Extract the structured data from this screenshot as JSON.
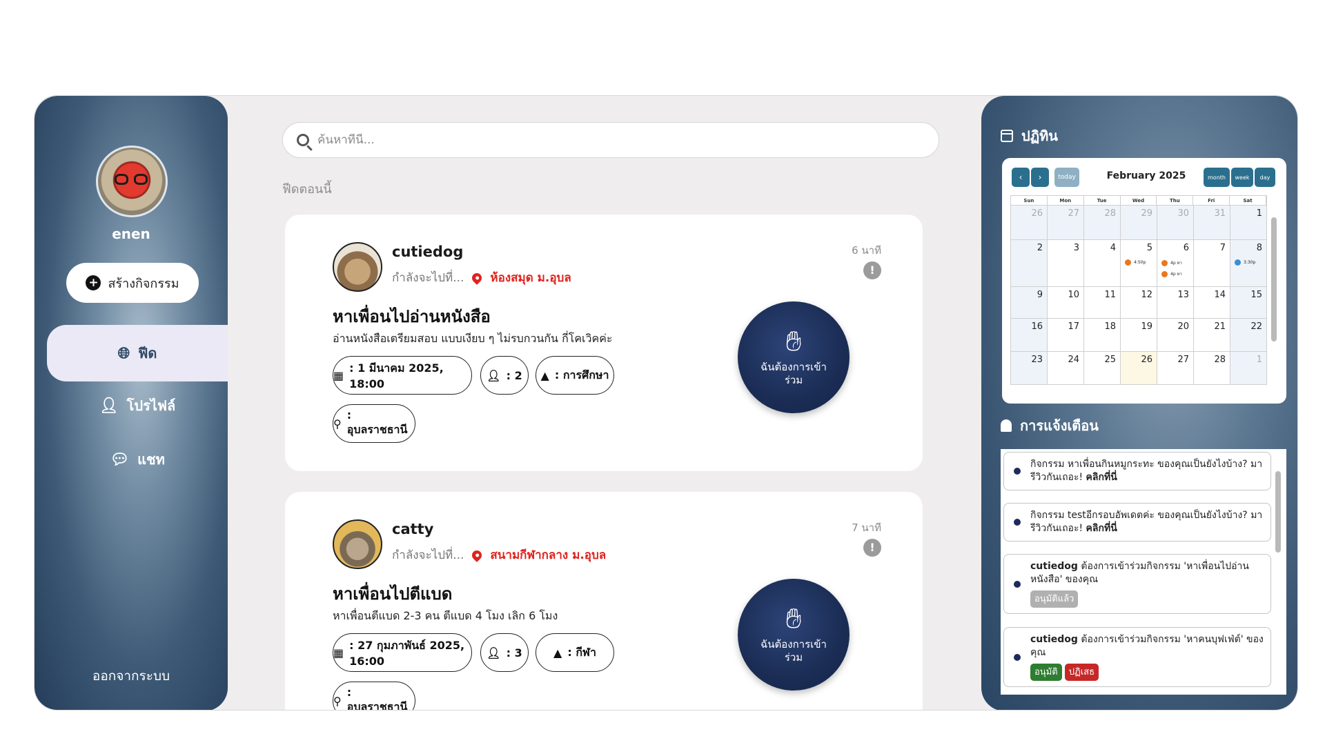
{
  "sidebar": {
    "username": "enen",
    "create_label": "สร้างกิจกรรม",
    "nav": [
      {
        "label": "ฟีด",
        "icon": "globe-icon"
      },
      {
        "label": "โปรไฟล์",
        "icon": "user-icon"
      },
      {
        "label": "แชท",
        "icon": "chat-icon"
      }
    ],
    "logout_label": "ออกจากระบบ"
  },
  "search": {
    "placeholder": "ค้นหาที่นี่..."
  },
  "feed": {
    "section_title": "ฟีดตอนนี้",
    "going_label": "กำลังจะไปที่...",
    "join_label": "ฉันต้องการเข้าร่วม",
    "posts": [
      {
        "username": "cutiedog",
        "place": "ห้องสมุด ม.อุบล",
        "time_ago": "6 นาที",
        "title": "หาเพื่อนไปอ่านหนังสือ",
        "description": "อ่านหนังสือเตรียมสอบ แบบเงียบ ๆ ไม่รบกวนกัน กี่โคเวิคค่ะ",
        "date": ": 1 มีนาคม 2025, 18:00",
        "people": ": 2",
        "category": ": การศึกษา",
        "province": ": อุบลราชธานี"
      },
      {
        "username": "catty",
        "place": "สนามกีฬากลาง ม.อุบล",
        "time_ago": "7 นาที",
        "title": "หาเพื่อนไปตีแบด",
        "description": "หาเพื่อนตีแบด 2-3 คน ตีแบด 4 โมง เลิก 6 โมง",
        "date": ": 27 กุมภาพันธ์ 2025, 16:00",
        "people": ": 3",
        "category": ": กีฬา",
        "province": ": อุบลราชธานี"
      }
    ]
  },
  "calendar": {
    "heading": "ปฏิทิน",
    "month_title": "February 2025",
    "today_label": "today",
    "view_buttons": [
      "month",
      "week",
      "day"
    ],
    "days_of_week": [
      "Sun",
      "Mon",
      "Tue",
      "Wed",
      "Thu",
      "Fri",
      "Sat"
    ],
    "weeks": [
      [
        "26",
        "27",
        "28",
        "29",
        "30",
        "31",
        "1"
      ],
      [
        "2",
        "3",
        "4",
        "5",
        "6",
        "7",
        "8"
      ],
      [
        "9",
        "10",
        "11",
        "12",
        "13",
        "14",
        "15"
      ],
      [
        "16",
        "17",
        "18",
        "19",
        "20",
        "21",
        "22"
      ],
      [
        "23",
        "24",
        "25",
        "26",
        "27",
        "28",
        "1"
      ]
    ],
    "events": [
      {
        "label": "4:50p",
        "color": "#e8781e"
      },
      {
        "label": "4p หา",
        "color": "#e8781e"
      },
      {
        "label": "4p หา",
        "color": "#e8781e"
      },
      {
        "label": "3:30p",
        "color": "#3a8fd6"
      }
    ]
  },
  "notifications": {
    "heading": "การแจ้งเตือน",
    "items": [
      {
        "text": "กิจกรรม หาเพื่อนกินหมูกระทะ ของคุณเป็นยังไงบ้าง? มารีวิวกันเถอะ! ",
        "link": "คลิกที่นี่"
      },
      {
        "text": "กิจกรรม testอีกรอบอัพเดตค่ะ ของคุณเป็นยังไงบ้าง? มารีวิวกันเถอะ! ",
        "link": "คลิกที่นี่"
      },
      {
        "user": "cutiedog",
        "text": " ต้องการเข้าร่วมกิจกรรม 'หาเพื่อนไปอ่านหนังสือ' ของคุณ",
        "status": "อนุมัติแล้ว"
      },
      {
        "user": "cutiedog",
        "text": " ต้องการเข้าร่วมกิจกรรม 'หาคนบุฟเฟ่ต์' ของคุณ",
        "approve": "อนุมัติ",
        "reject": "ปฏิเสธ"
      }
    ]
  },
  "colors": {
    "accent": "#1b2d55",
    "place": "#e0221d",
    "approve": "#2e7d32",
    "reject": "#c62828",
    "approved_badge": "#b0b0b0"
  }
}
